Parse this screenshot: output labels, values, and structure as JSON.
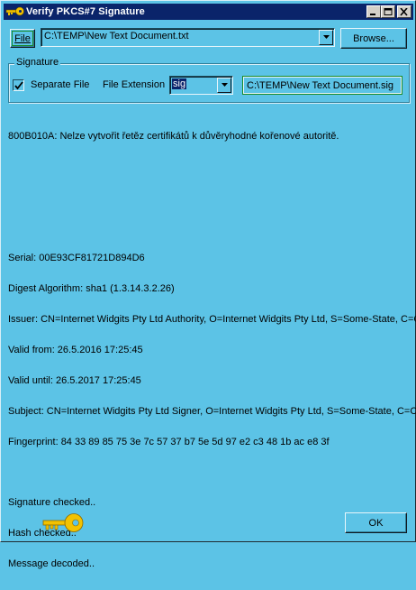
{
  "window": {
    "title": "Verify PKCS#7 Signature",
    "icon": "key-icon"
  },
  "file_row": {
    "file_button_label": "File",
    "file_path": "C:\\TEMP\\New Text Document.txt",
    "browse_label": "Browse..."
  },
  "signature_group": {
    "label": "Signature",
    "separate_file_label": "Separate File",
    "separate_file_checked": true,
    "extension_label": "File Extension",
    "extension_value": "sig",
    "signature_path": "C:\\TEMP\\New Text Document.sig"
  },
  "output_lines": [
    "800B010A: Nelze vytvořit řetěz certifikátů k důvěryhodné kořenové autoritě.",
    "",
    "",
    "",
    "Serial: 00E93CF81721D894D6",
    "Digest Algorithm: sha1 (1.3.14.3.2.26)",
    "Issuer: CN=Internet Widgits Pty Ltd Authority, O=Internet Widgits Pty Ltd, S=Some-State, C=CZ",
    "Valid from: 26.5.2016 17:25:45",
    "Valid until: 26.5.2017 17:25:45",
    "Subject: CN=Internet Widgits Pty Ltd Signer, O=Internet Widgits Pty Ltd, S=Some-State, C=CZ",
    "Fingerprint: 84 33 89 85 75 3e 7c 57 37 b7 5e 5d 97 e2 c3 48 1b ac e8 3f",
    "",
    "Signature checked..",
    "Hash checked..",
    "Message decoded.."
  ],
  "ok_label": "OK",
  "colors": {
    "background": "#5cc3e6",
    "titlebar": "#0a246a",
    "key": "#f2c200",
    "focus_border": "#1a8a2a"
  }
}
